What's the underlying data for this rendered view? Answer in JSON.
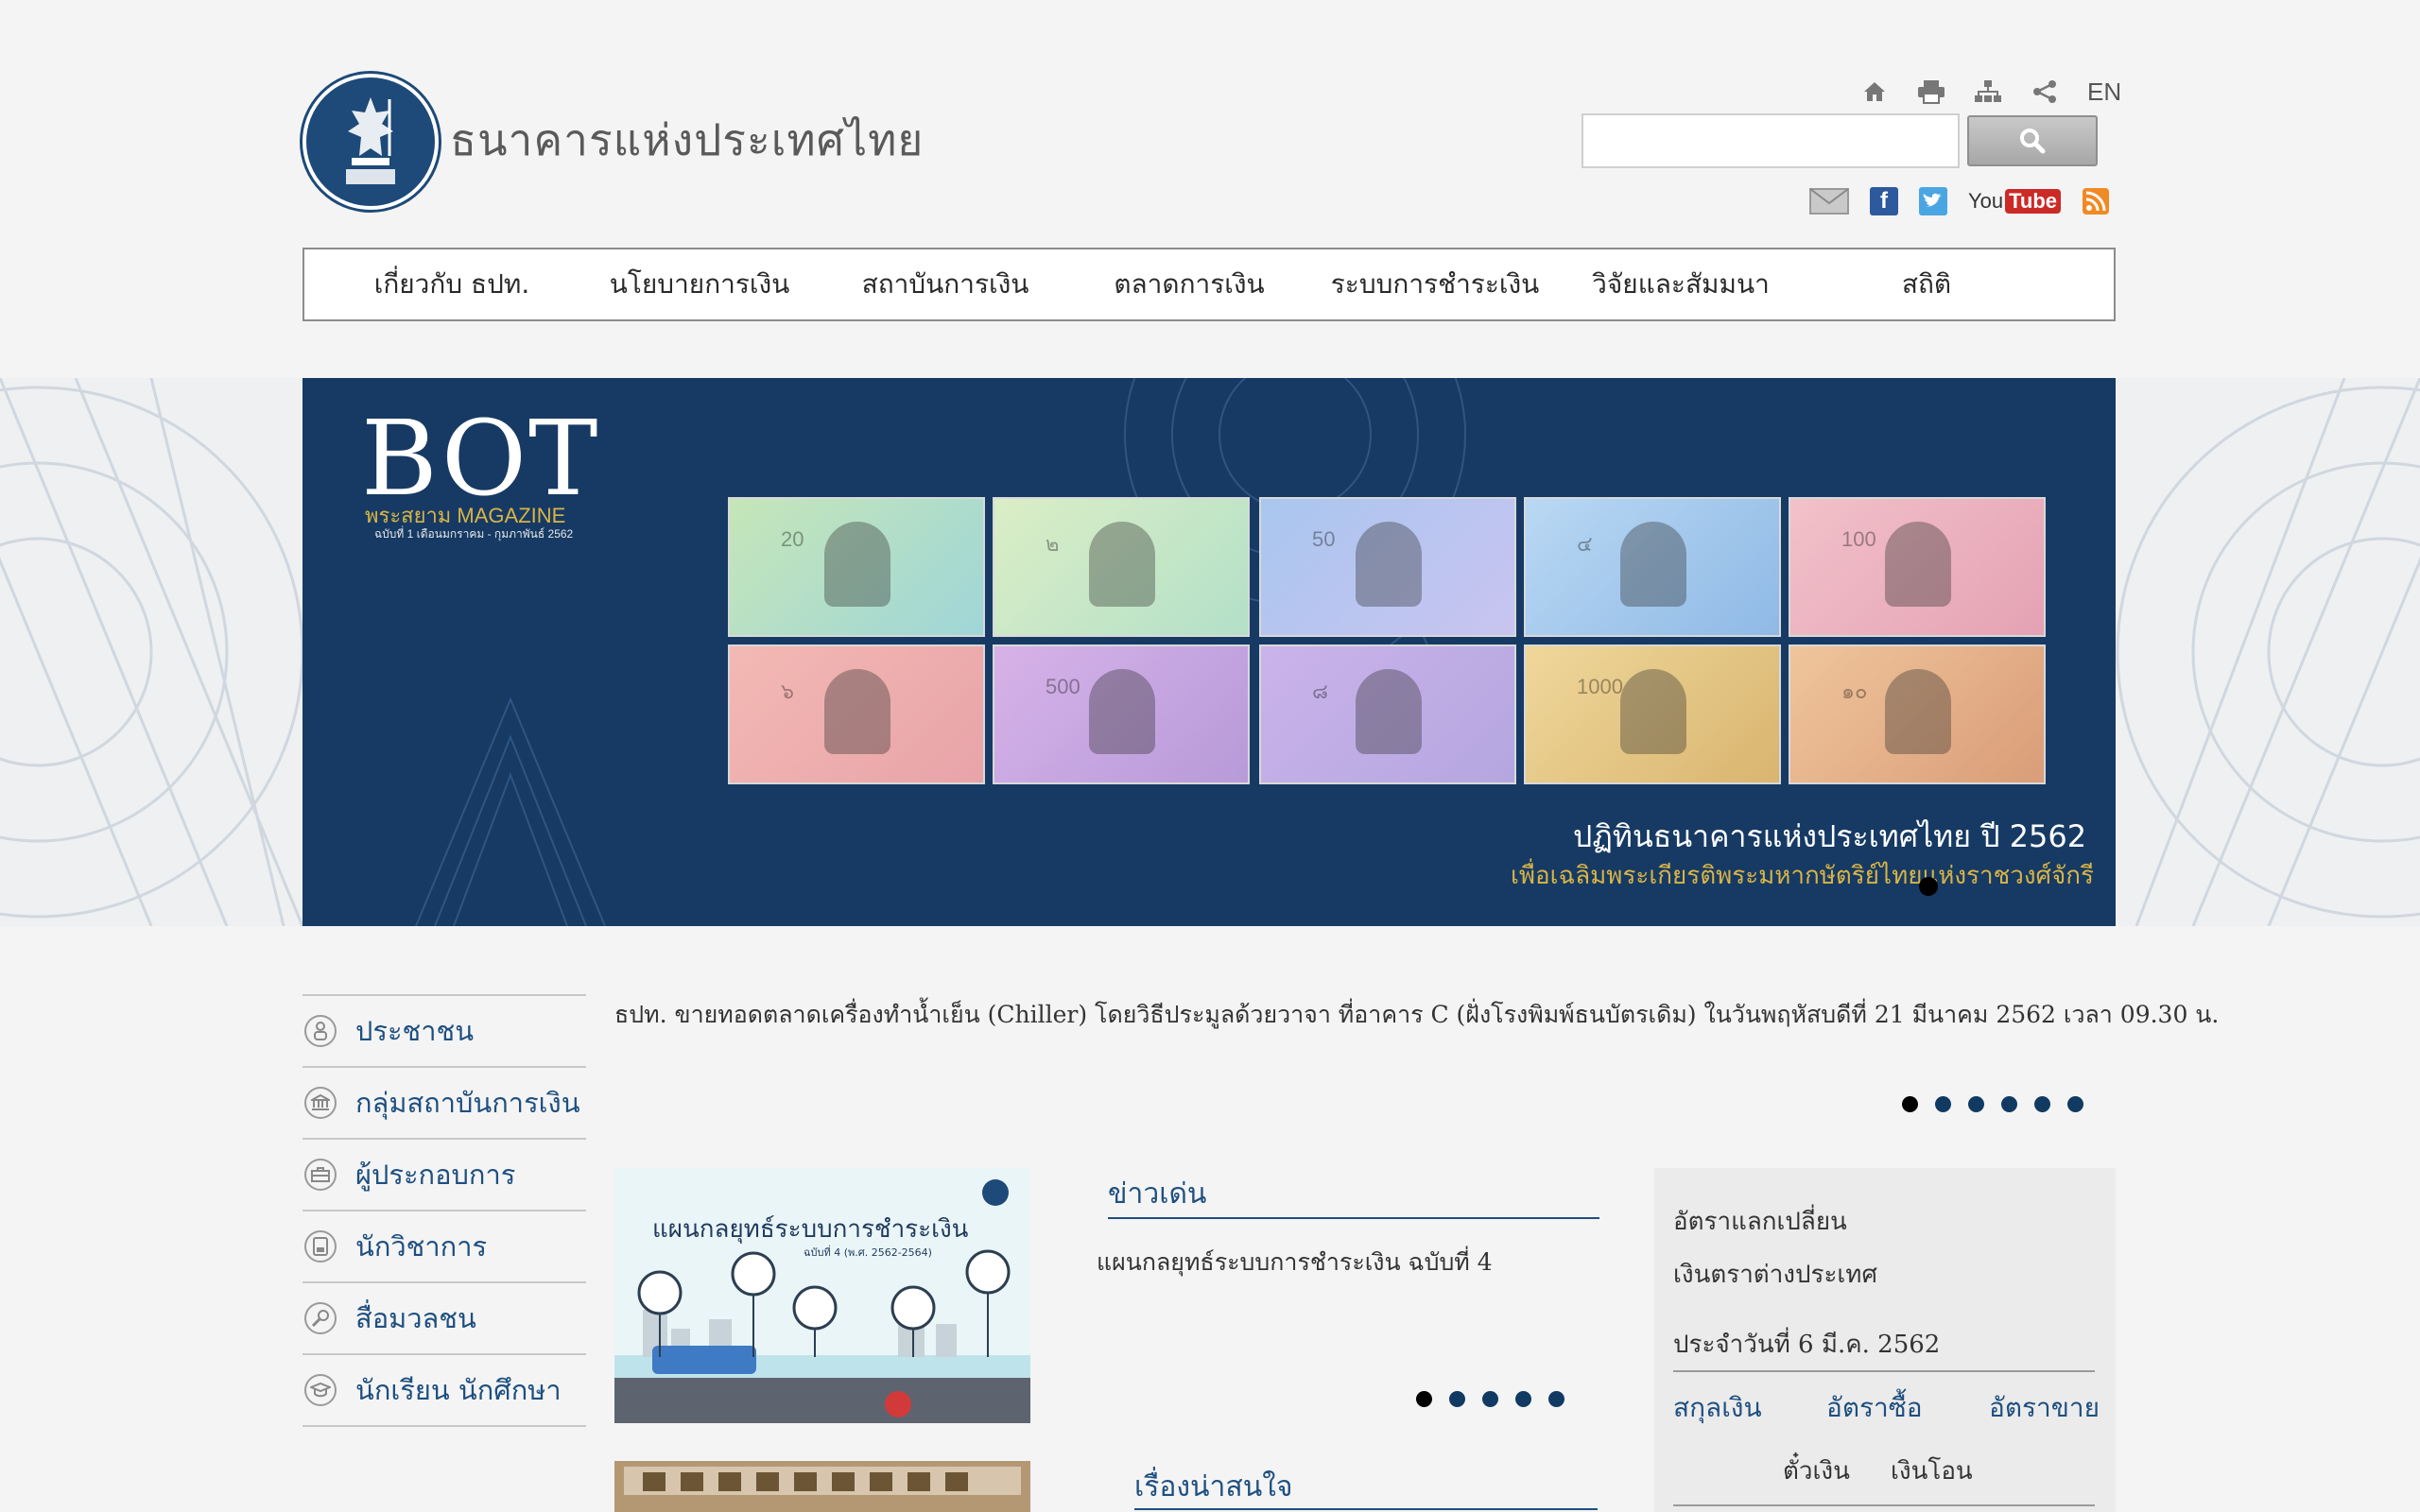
{
  "header": {
    "site_title": "ธนาคารแห่งประเทศไทย",
    "lang_label": "EN",
    "search": {
      "value": "",
      "placeholder": ""
    },
    "util_icons": [
      "home-icon",
      "print-icon",
      "sitemap-icon",
      "share-icon"
    ],
    "social": {
      "email": "email-icon",
      "facebook": "facebook-icon",
      "twitter": "twitter-icon",
      "youtube_you": "You",
      "youtube_tube": "Tube",
      "rss": "rss-icon"
    }
  },
  "nav": {
    "items": [
      "เกี่ยวกับ ธปท.",
      "นโยบายการเงิน",
      "สถาบันการเงิน",
      "ตลาดการเงิน",
      "ระบบการชำระเงิน",
      "วิจัยและสัมมนา",
      "สถิติ"
    ]
  },
  "banner": {
    "logo": "BOT",
    "subtitle": "พระสยาม MAGAZINE",
    "issue": "ฉบับที่ 1 เดือนมกราคม - กุมภาพันธ์ 2562",
    "caption": "ปฏิทินธนาคารแห่งประเทศไทย ปี 2562",
    "subcaption": "เพื่อเฉลิมพระเกียรติพระมหากษัตริย์ไทยแห่งราชวงศ์จักรี",
    "notes": [
      "20",
      "๒",
      "50",
      "๔",
      "100",
      "๖",
      "500",
      "๘",
      "1000",
      "๑๐"
    ]
  },
  "audience_menu": [
    {
      "label": "ประชาชน",
      "icon": "person-icon"
    },
    {
      "label": "กลุ่มสถาบันการเงิน",
      "icon": "bank-icon"
    },
    {
      "label": "ผู้ประกอบการ",
      "icon": "briefcase-icon"
    },
    {
      "label": "นักวิชาการ",
      "icon": "book-icon"
    },
    {
      "label": "สื่อมวลชน",
      "icon": "microphone-icon"
    },
    {
      "label": "นักเรียน นักศึกษา",
      "icon": "graduation-cap-icon"
    }
  ],
  "ticker": {
    "text": "ธปท. ขายทอดตลาดเครื่องทำน้ำเย็น (Chiller) โดยวิธีประมูลด้วยวาจา ที่อาคาร C (ฝั่งโรงพิมพ์ธนบัตรเดิม) ในวันพฤหัสบดีที่ 21 มีนาคม 2562 เวลา 09.30 น.",
    "dot_count": 6,
    "active_index": 0
  },
  "feature": {
    "image_title": "แผนกลยุทธ์ระบบการชำระเงิน",
    "image_subtitle": "ฉบับที่ 4 (พ.ศ. 2562-2564)"
  },
  "highlight": {
    "title": "ข่าวเด่น",
    "item": "แผนกลยุทธ์ระบบการชำระเงิน ฉบับที่ 4",
    "dot_count": 5,
    "active_index": 0
  },
  "interesting": {
    "title": "เรื่องน่าสนใจ"
  },
  "fx": {
    "title_line1": "อัตราแลกเปลี่ยน",
    "title_line2": "เงินตราต่างประเทศ",
    "date": "ประจำวันที่ 6 มี.ค. 2562",
    "col_currency": "สกุลเงิน",
    "col_buy": "อัตราซื้อ",
    "col_sell": "อัตราขาย",
    "sub_draft": "ตั๋วเงิน",
    "sub_transfer": "เงินโอน"
  },
  "colors": {
    "primary": "#1e4f80",
    "banner": "#163a64",
    "gold": "#d9b445"
  }
}
